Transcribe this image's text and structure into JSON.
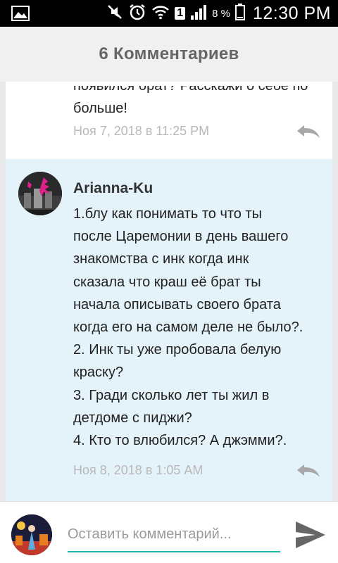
{
  "status_bar": {
    "icons": [
      "gallery-icon",
      "mute-icon",
      "alarm-icon",
      "wifi-icon",
      "sim-icon",
      "signal-icon",
      "battery-icon"
    ],
    "sim_number": "1",
    "battery_percent": "8 %",
    "time": "12:30 PM"
  },
  "header": {
    "title": "6 Комментариев"
  },
  "comments": [
    {
      "text_lines": [
        "появился брат? Расскажи о себе по",
        "больше!"
      ],
      "date": "Ноя 7, 2018 в 11:25 PM"
    },
    {
      "author": "Arianna-Ku",
      "text_lines": [
        "1.блу как понимать то что ты",
        "после Царемонии в день вашего",
        "знакомства с инк когда инк",
        "сказала что краш её брат ты",
        "начала описывать своего брата",
        "когда его на самом деле не было?.",
        "2. Инк ты уже пробовала белую",
        "краску?",
        "3. Гради сколько лет ты жил в",
        "детдоме с пиджи?",
        "4. Кто то влюбился? А джэмми?."
      ],
      "date": "Ноя 8, 2018 в 1:05 AM"
    }
  ],
  "composer": {
    "placeholder": "Оставить комментарий..."
  },
  "colors": {
    "accent": "#1fb0a8",
    "highlight_bg": "#e4f3f9",
    "meta_text": "#b8b8b8"
  }
}
